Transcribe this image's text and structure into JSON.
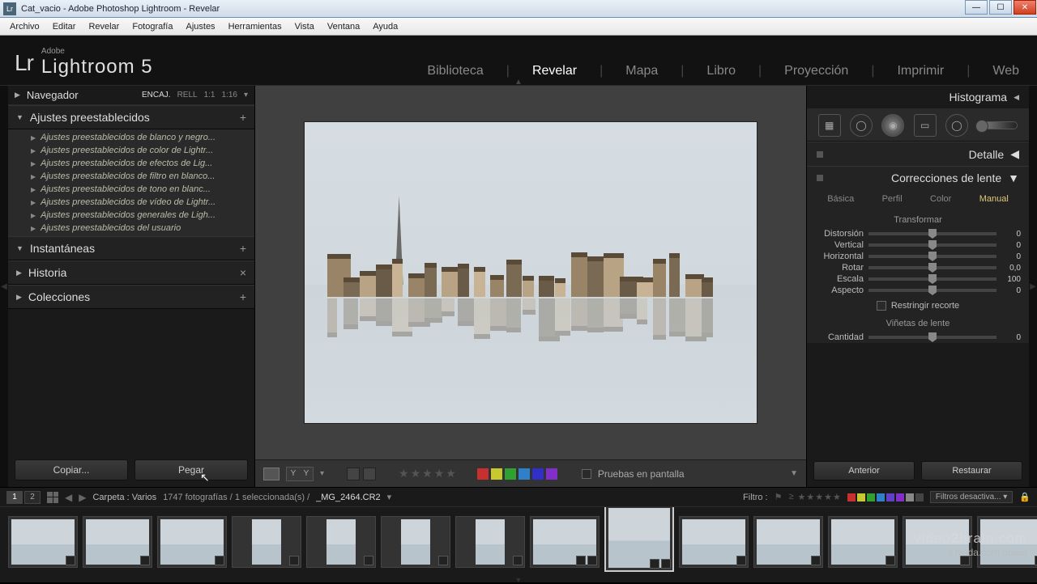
{
  "window": {
    "title": "Cat_vacio - Adobe Photoshop Lightroom - Revelar"
  },
  "menu": [
    "Archivo",
    "Editar",
    "Revelar",
    "Fotografía",
    "Ajustes",
    "Herramientas",
    "Vista",
    "Ventana",
    "Ayuda"
  ],
  "logo": {
    "abbr": "Lr",
    "small": "Adobe",
    "big": "Lightroom 5"
  },
  "modules": [
    "Biblioteca",
    "Revelar",
    "Mapa",
    "Libro",
    "Proyección",
    "Imprimir",
    "Web"
  ],
  "active_module": "Revelar",
  "left": {
    "navegador": {
      "label": "Navegador",
      "zoom": [
        "ENCAJ.",
        "RELL",
        "1:1",
        "1:16"
      ],
      "zoom_active": "ENCAJ."
    },
    "presets": {
      "label": "Ajustes preestablecidos",
      "items": [
        "Ajustes preestablecidos de blanco y negro...",
        "Ajustes preestablecidos de color de Lightr...",
        "Ajustes preestablecidos de efectos de Lig...",
        "Ajustes preestablecidos de filtro en blanco...",
        "Ajustes preestablecidos de tono en blanc...",
        "Ajustes preestablecidos de vídeo de Lightr...",
        "Ajustes preestablecidos generales de Ligh...",
        "Ajustes preestablecidos del usuario"
      ]
    },
    "instantaneas": "Instantáneas",
    "historia": "Historia",
    "colecciones": "Colecciones",
    "copy": "Copiar...",
    "paste": "Pegar"
  },
  "center": {
    "softproof": "Pruebas en pantalla",
    "colors": [
      "#c83030",
      "#c8c830",
      "#30a030",
      "#3080c8",
      "#3030c8",
      "#8030c8"
    ]
  },
  "right": {
    "histograma": "Histograma",
    "detalle": "Detalle",
    "lente": "Correcciones de lente",
    "tabs": [
      "Básica",
      "Perfil",
      "Color",
      "Manual"
    ],
    "active_tab": "Manual",
    "transformar": "Transformar",
    "sliders": [
      {
        "label": "Distorsión",
        "val": "0"
      },
      {
        "label": "Vertical",
        "val": "0"
      },
      {
        "label": "Horizontal",
        "val": "0"
      },
      {
        "label": "Rotar",
        "val": "0,0"
      },
      {
        "label": "Escala",
        "val": "100"
      },
      {
        "label": "Aspecto",
        "val": "0"
      }
    ],
    "constrain": "Restringir recorte",
    "vinetas": "Viñetas de lente",
    "cantidad": {
      "label": "Cantidad",
      "val": "0"
    },
    "anterior": "Anterior",
    "restaurar": "Restaurar"
  },
  "filmstrip": {
    "path_label": "Carpeta :",
    "path_value": "Varios",
    "stats": "1747 fotografías / 1 seleccionada(s) /",
    "filename": "_MG_2464.CR2",
    "filtro": "Filtro :",
    "filter_off": "Filtros desactiva...",
    "filter_colors": [
      "#c83030",
      "#c8c830",
      "#30a030",
      "#3080c8",
      "#6040c8",
      "#8030c8",
      "#888",
      "#444"
    ]
  },
  "watermark": {
    "l1_a": "video",
    "l1_b": "2",
    "l1_c": "brain",
    "l1_d": ".com",
    "l2": "a lynda.com brand"
  }
}
